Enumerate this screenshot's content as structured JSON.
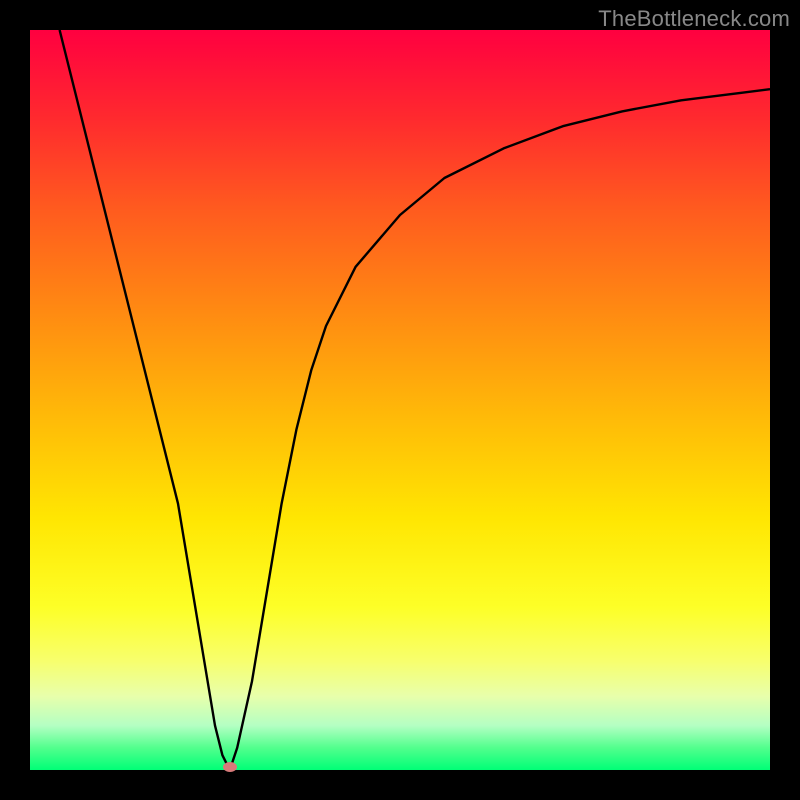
{
  "watermark": "TheBottleneck.com",
  "chart_data": {
    "type": "line",
    "title": "",
    "xlabel": "",
    "ylabel": "",
    "xlim": [
      0,
      100
    ],
    "ylim": [
      0,
      100
    ],
    "grid": false,
    "legend": false,
    "series": [
      {
        "name": "curve",
        "x": [
          4,
          8,
          12,
          16,
          20,
          23,
          25,
          26,
          27,
          28,
          30,
          32,
          34,
          36,
          38,
          40,
          44,
          50,
          56,
          64,
          72,
          80,
          88,
          96,
          100
        ],
        "values": [
          100,
          84,
          68,
          52,
          36,
          18,
          6,
          2,
          0,
          3,
          12,
          24,
          36,
          46,
          54,
          60,
          68,
          75,
          80,
          84,
          87,
          89,
          90.5,
          91.5,
          92
        ]
      }
    ],
    "marker": {
      "x": 27,
      "y": 0
    },
    "colors": {
      "gradient_top": "#ff0040",
      "gradient_mid": "#ffe602",
      "gradient_bottom": "#00ff77",
      "curve": "#000000",
      "frame": "#000000",
      "marker": "#d87a7a"
    }
  }
}
